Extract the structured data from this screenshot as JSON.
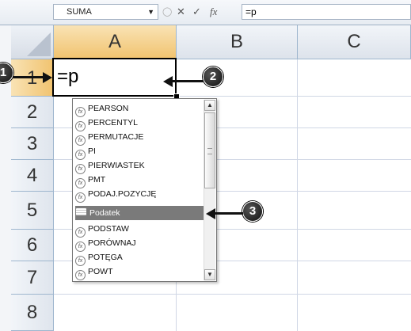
{
  "formula_bar": {
    "name_box": "SUMA",
    "cancel_glyph": "✕",
    "enter_glyph": "✓",
    "fx_glyph": "fx",
    "formula_text": "=p"
  },
  "columns": [
    "A",
    "B",
    "C"
  ],
  "rows": [
    "1",
    "2",
    "3",
    "4",
    "5",
    "6",
    "7",
    "8"
  ],
  "active_cell": {
    "ref": "A1",
    "value": "=p"
  },
  "autocomplete": {
    "items": [
      {
        "label": "PEARSON",
        "icon": "function-icon"
      },
      {
        "label": "PERCENTYL",
        "icon": "function-icon"
      },
      {
        "label": "PERMUTACJE",
        "icon": "function-icon"
      },
      {
        "label": "PI",
        "icon": "function-icon"
      },
      {
        "label": "PIERWIASTEK",
        "icon": "function-icon"
      },
      {
        "label": "PMT",
        "icon": "function-icon"
      },
      {
        "label": "PODAJ.POZYCJĘ",
        "icon": "function-icon"
      },
      {
        "label": "Podatek",
        "icon": "table-name-icon"
      },
      {
        "label": "PODSTAW",
        "icon": "function-icon"
      },
      {
        "label": "PORÓWNAJ",
        "icon": "function-icon"
      },
      {
        "label": "POTĘGA",
        "icon": "function-icon"
      },
      {
        "label": "POWT",
        "icon": "function-icon"
      }
    ],
    "highlighted_index": 7
  },
  "callouts": [
    "1",
    "2",
    "3"
  ],
  "colors": {
    "header_selected": "#f1c36f",
    "grid_line": "#d0d7e5",
    "highlight_item": "#7a7a7a"
  }
}
